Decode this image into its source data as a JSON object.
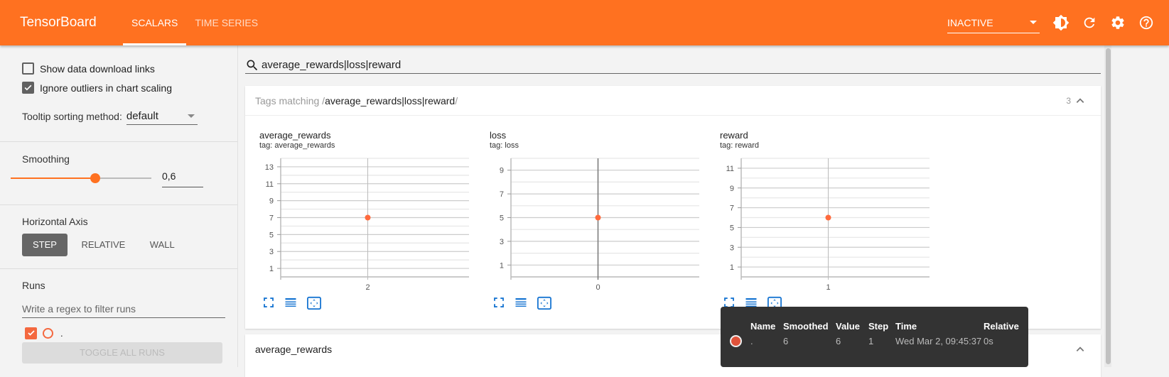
{
  "topbar": {
    "brand": "TensorBoard",
    "tabs": [
      {
        "label": "SCALARS",
        "active": true
      },
      {
        "label": "TIME SERIES",
        "active": false
      }
    ],
    "run_selector": "INACTIVE",
    "icons": [
      "theme-icon",
      "refresh-icon",
      "settings-icon",
      "help-icon"
    ],
    "accent": "#ff7120"
  },
  "sidebar": {
    "show_download_links": {
      "label": "Show data download links",
      "checked": false
    },
    "ignore_outliers": {
      "label": "Ignore outliers in chart scaling",
      "checked": true
    },
    "tooltip_sorting": {
      "label": "Tooltip sorting method:",
      "value": "default"
    },
    "smoothing": {
      "label": "Smoothing",
      "value": "0,6",
      "fraction": 0.6
    },
    "horizontal_axis": {
      "label": "Horizontal Axis",
      "options": [
        "STEP",
        "RELATIVE",
        "WALL"
      ],
      "selected": "STEP"
    },
    "runs": {
      "label": "Runs",
      "filter_placeholder": "Write a regex to filter runs",
      "items": [
        {
          "name": ".",
          "checked": true,
          "color": "#f4683f"
        }
      ],
      "toggle_all_label": "TOGGLE ALL RUNS"
    }
  },
  "main": {
    "search_value": "average_rewards|loss|reward",
    "tag_card": {
      "prefix": "Tags matching /",
      "pattern": "average_rewards|loss|reward",
      "suffix": "/",
      "count": "3"
    },
    "next_card_title": "average_rewards"
  },
  "chart_data": [
    {
      "type": "scatter",
      "title": "average_rewards",
      "tag": "tag: average_rewards",
      "x": [
        2
      ],
      "y": [
        7
      ],
      "xticks": [
        "2"
      ],
      "yticks": [
        1,
        3,
        5,
        7,
        9,
        11,
        13
      ],
      "ylim": [
        0,
        14
      ],
      "grid": true
    },
    {
      "type": "scatter",
      "title": "loss",
      "tag": "tag: loss",
      "x": [
        0
      ],
      "y": [
        5
      ],
      "xticks": [
        "0"
      ],
      "yticks": [
        1,
        3,
        5,
        7,
        9
      ],
      "ylim": [
        0,
        10
      ],
      "grid": true
    },
    {
      "type": "scatter",
      "title": "reward",
      "tag": "tag: reward",
      "x": [
        1
      ],
      "y": [
        6
      ],
      "xticks": [
        "1"
      ],
      "yticks": [
        1,
        3,
        5,
        7,
        9,
        11
      ],
      "ylim": [
        0,
        12
      ],
      "grid": true
    }
  ],
  "tooltip": {
    "headers": [
      "Name",
      "Smoothed",
      "Value",
      "Step",
      "Time",
      "Relative"
    ],
    "rows": [
      {
        "name": ".",
        "smoothed": "6",
        "value": "6",
        "step": "1",
        "time": "Wed Mar 2, 09:45:37",
        "relative": "0s",
        "color": "#e0533b"
      }
    ]
  }
}
